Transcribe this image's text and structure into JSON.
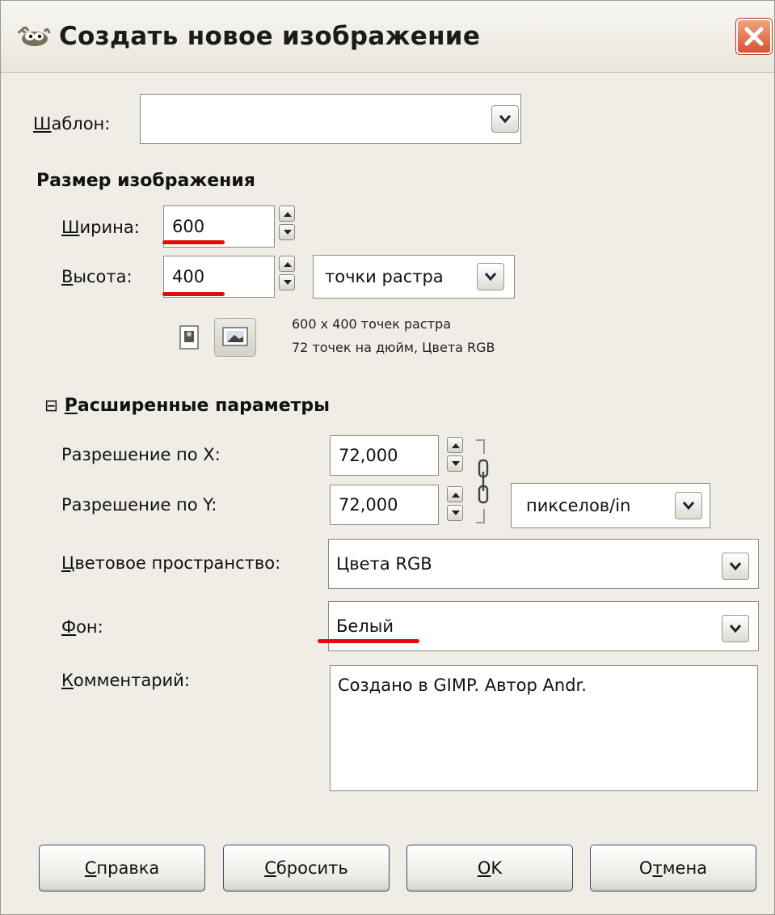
{
  "window": {
    "title": "Создать новое изображение",
    "icons": {
      "app": "gimp-wilber-icon",
      "close": "close-icon"
    }
  },
  "template": {
    "label_key": "Ш",
    "label_rest": "аблон:",
    "value": ""
  },
  "image_size": {
    "heading": "Размер изображения",
    "width_label_key": "Ш",
    "width_label_rest": "ирина:",
    "width_value": "600",
    "height_label_key": "В",
    "height_label_rest": "ысота:",
    "height_value": "400",
    "unit": "точки растра",
    "info_line1": "600 x 400 точек растра",
    "info_line2": "72 точек на дюйм, Цвета RGB",
    "orientation_icons": [
      "portrait-icon",
      "landscape-icon"
    ]
  },
  "advanced": {
    "toggle_symbol": "⊟",
    "heading_key": "Р",
    "heading_rest": "асширенные параметры",
    "res_x_label": "Разрешение по X:",
    "res_x_value": "72,000",
    "res_y_label": "Разрешение по Y:",
    "res_y_value": "72,000",
    "res_unit": "пикселов/in",
    "chain_icon": "chain-link-icon",
    "colorspace_label_key": "Ц",
    "colorspace_label_rest": "ветовое пространство:",
    "colorspace_value": "Цвета RGB",
    "fill_label_key": "Ф",
    "fill_label_rest": "он:",
    "fill_value": "Белый",
    "comment_label_key": "К",
    "comment_label_rest": "омментарий:",
    "comment_value": "Создано в GIMP. Автор Andr."
  },
  "buttons": {
    "help_key": "С",
    "help_rest": "правка",
    "reset_key": "С",
    "reset_rest": "бросить",
    "ok_key": "O",
    "ok_rest": "K",
    "cancel_pre": "О",
    "cancel_key": "т",
    "cancel_rest": "мена"
  },
  "colors": {
    "annotation_red": "#e30c0c",
    "dialog_bg": "#efede6",
    "button_border": "#3a4f78"
  }
}
